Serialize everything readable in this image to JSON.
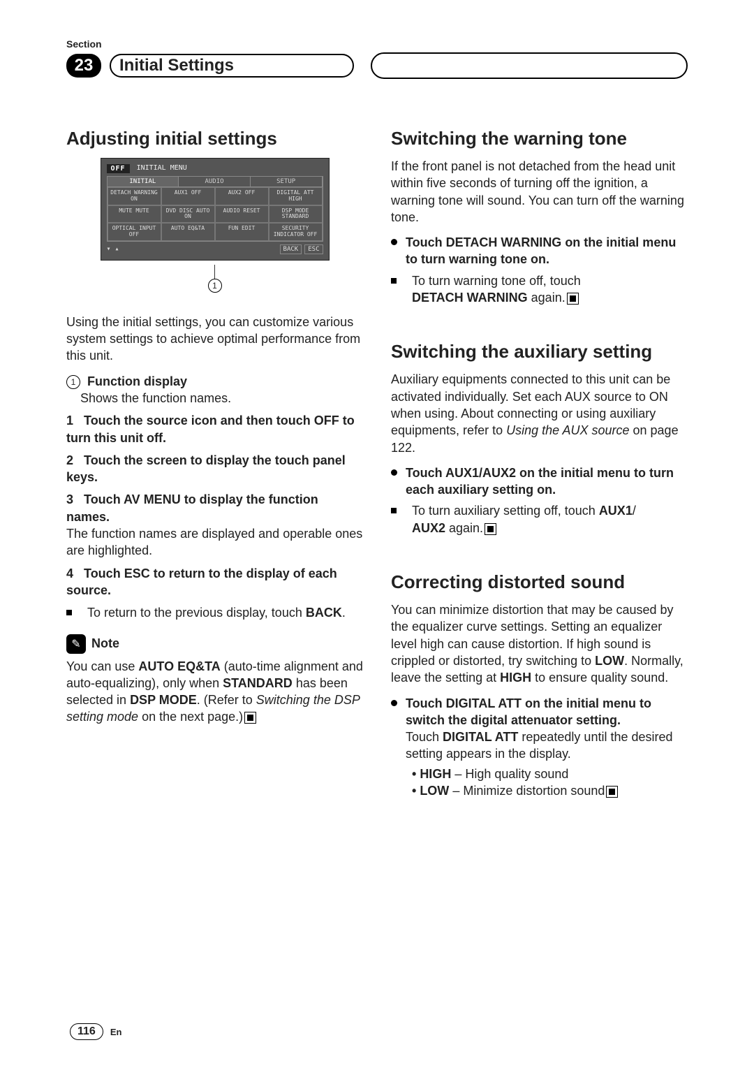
{
  "section_label": "Section",
  "chapter_number": "23",
  "chapter_title": "Initial Settings",
  "screenshot": {
    "top_left": "OFF",
    "top_right": "INITIAL MENU",
    "tabs": [
      "INITIAL",
      "AUDIO",
      "SETUP"
    ],
    "grid": [
      [
        "DETACH WARNING ON",
        "AUX1 OFF",
        "AUX2 OFF",
        "DIGITAL ATT HIGH"
      ],
      [
        "MUTE MUTE",
        "DVD DISC AUTO ON",
        "AUDIO RESET",
        "DSP MODE STANDARD"
      ],
      [
        "OPTICAL INPUT OFF",
        "AUTO EQ&TA",
        "FUN EDIT",
        "SECURITY INDICATOR OFF"
      ]
    ],
    "footer_back": "BACK",
    "footer_esc": "ESC",
    "callout": "1"
  },
  "left": {
    "h1": "Adjusting initial settings",
    "intro": "Using the initial settings, you can customize various system settings to achieve optimal performance from this unit.",
    "fn_label": "Function display",
    "fn_desc": "Shows the function names.",
    "step1_n": "1",
    "step1": "Touch the source icon and then touch OFF to turn this unit off.",
    "step2_n": "2",
    "step2": "Touch the screen to display the touch panel keys.",
    "step3_n": "3",
    "step3": "Touch AV MENU to display the function names.",
    "step3_desc": "The function names are displayed and operable ones are highlighted.",
    "step4_n": "4",
    "step4": "Touch ESC to return to the display of each source.",
    "step4_bullet_a": "To return to the previous display, touch ",
    "step4_bullet_b": "BACK",
    "step4_bullet_c": ".",
    "note_label": "Note",
    "note_a": "You can use ",
    "note_b": "AUTO EQ&TA",
    "note_c": " (auto-time alignment and auto-equalizing), only when ",
    "note_d": "STANDARD",
    "note_e": " has been selected in ",
    "note_f": "DSP MODE",
    "note_g": ". (Refer to ",
    "note_h": "Switching the DSP setting mode",
    "note_i": " on the next page.)"
  },
  "right": {
    "h1": "Switching the warning tone",
    "p1": "If the front panel is not detached from the head unit within five seconds of turning off the ignition, a warning tone will sound. You can turn off the warning tone.",
    "b1": "Touch DETACH WARNING on the initial menu to turn warning tone on.",
    "sq1_a": "To turn warning tone off, touch",
    "sq1_b": "DETACH WARNING",
    "sq1_c": " again.",
    "h2": "Switching the auxiliary setting",
    "p2_a": "Auxiliary equipments connected to this unit can be activated individually. Set each AUX source to ON when using. About connecting or using auxiliary equipments, refer to ",
    "p2_b": "Using the AUX source",
    "p2_c": " on page 122.",
    "b2": "Touch AUX1/AUX2 on the initial menu to turn each auxiliary setting on.",
    "sq2_a": "To turn auxiliary setting off, touch ",
    "sq2_b": "AUX1",
    "sq2_c": "/",
    "sq2_d": "AUX2",
    "sq2_e": " again.",
    "h3": "Correcting distorted sound",
    "p3_a": "You can minimize distortion that may be caused by the equalizer curve settings. Setting an equalizer level high can cause distortion. If high sound is crippled or distorted, try switching to ",
    "p3_b": "LOW",
    "p3_c": ". Normally, leave the setting at ",
    "p3_d": "HIGH",
    "p3_e": " to ensure quality sound.",
    "b3": "Touch DIGITAL ATT on the initial menu to switch the digital attenuator setting.",
    "b3_desc_a": "Touch ",
    "b3_desc_b": "DIGITAL ATT",
    "b3_desc_c": " repeatedly until the desired setting appears in the display.",
    "li1_a": "HIGH",
    "li1_b": " – High quality sound",
    "li2_a": "LOW",
    "li2_b": " – Minimize distortion sound"
  },
  "page_number": "116",
  "page_lang": "En"
}
